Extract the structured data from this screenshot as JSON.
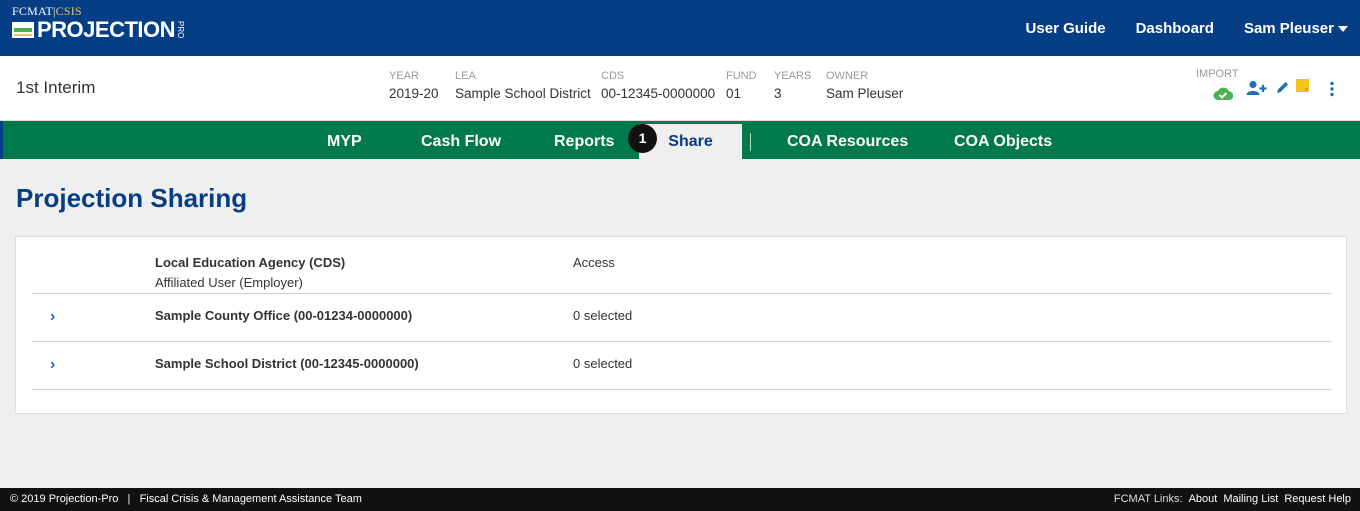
{
  "header": {
    "logo_top_a": "FCMAT",
    "logo_top_sep": "|",
    "logo_top_b": "CSIS",
    "logo_main": "PROJECTION",
    "logo_pro": "PRO",
    "nav": [
      "User Guide",
      "Dashboard",
      "Sam Pleuser"
    ]
  },
  "info": {
    "title": "1st Interim",
    "fields": [
      {
        "key": "YEAR",
        "value": "2019-20"
      },
      {
        "key": "LEA",
        "value": "Sample School District"
      },
      {
        "key": "CDS",
        "value": "00-12345-0000000"
      },
      {
        "key": "FUND",
        "value": "01"
      },
      {
        "key": "YEARS",
        "value": "3"
      },
      {
        "key": "OWNER",
        "value": "Sam Pleuser"
      }
    ],
    "import_label": "IMPORT"
  },
  "tabs": [
    "MYP",
    "Cash Flow",
    "Reports",
    "Share",
    "COA Resources",
    "COA Objects"
  ],
  "active_tab": "Share",
  "badge": "1",
  "page": {
    "title": "Projection Sharing",
    "col_lea": "Local Education Agency (CDS)",
    "col_lea_sub": "Affiliated User (Employer)",
    "col_access": "Access",
    "rows": [
      {
        "name": "Sample County Office (00-01234-0000000)",
        "access": "0 selected"
      },
      {
        "name": "Sample School District (00-12345-0000000)",
        "access": "0 selected"
      }
    ]
  },
  "footer": {
    "left": "© 2019 Projection-Pro   |   Fiscal Crisis & Management Assistance Team",
    "links_label": "FCMAT Links:",
    "links": [
      "About",
      "Mailing List",
      "Request Help"
    ]
  },
  "colors": {
    "navy": "#063e86",
    "green": "#007a4a",
    "accent_green": "#4caf50",
    "yellow": "#f5c518"
  }
}
